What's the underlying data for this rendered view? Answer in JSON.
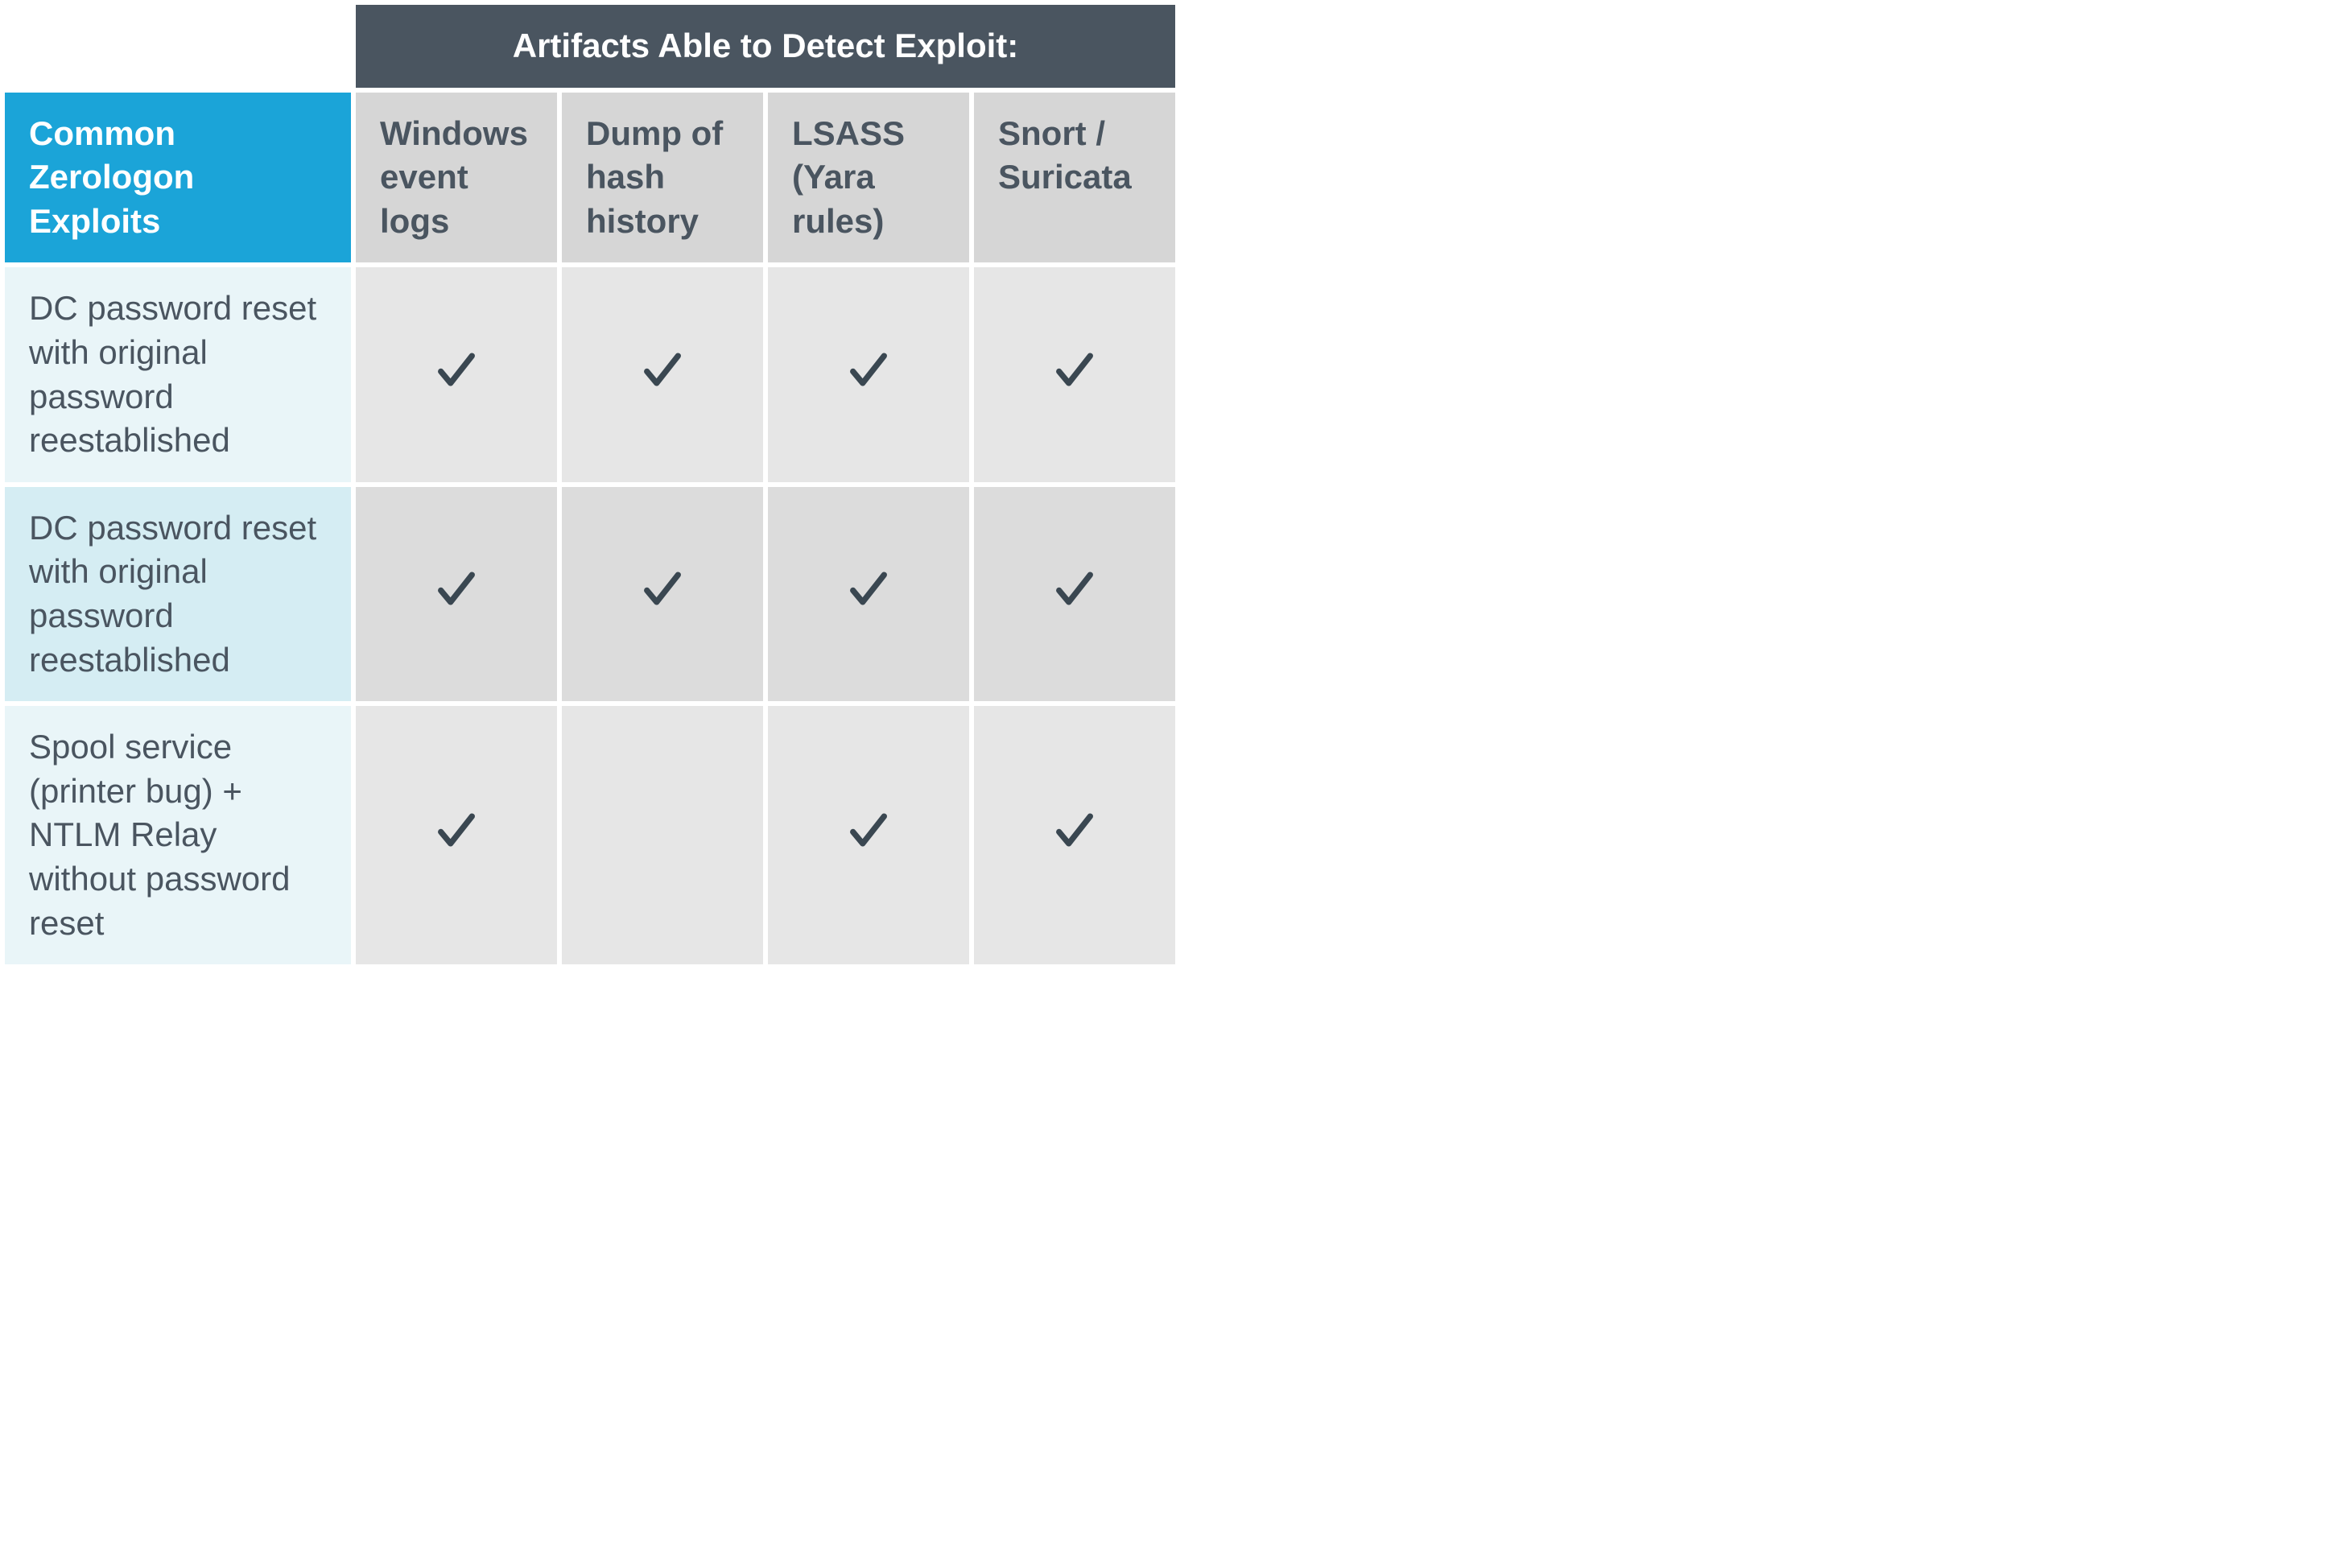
{
  "header": {
    "banner": "Artifacts Able to Detect Exploit:",
    "rowHeader": "Common Zerologon Exploits",
    "columns": [
      "Windows event logs",
      "Dump of hash history",
      "LSASS (Yara rules)",
      "Snort / Suricata"
    ]
  },
  "rows": [
    {
      "label": "DC password reset with original password reestablished",
      "cells": [
        true,
        true,
        true,
        true
      ]
    },
    {
      "label": "DC password reset with original password reestablished",
      "cells": [
        true,
        true,
        true,
        true
      ]
    },
    {
      "label": "Spool service (printer bug) + NTLM Relay without password reset",
      "cells": [
        true,
        false,
        true,
        true
      ]
    }
  ],
  "colors": {
    "bannerBg": "#4a5560",
    "blueHeader": "#1ba4d8",
    "grayHeader": "#d6d6d6",
    "rowA": "#e9f5f8",
    "rowB": "#d5edf3",
    "cellA": "#e6e6e6",
    "cellB": "#dcdcdc",
    "checkColor": "#3a4751"
  },
  "icons": {
    "check": "check-icon"
  },
  "chart_data": {
    "type": "table",
    "title": "Artifacts Able to Detect Exploit:",
    "row_header": "Common Zerologon Exploits",
    "columns": [
      "Windows event logs",
      "Dump of hash history",
      "LSASS (Yara rules)",
      "Snort / Suricata"
    ],
    "rows": [
      {
        "label": "DC password reset with original password reestablished",
        "values": [
          true,
          true,
          true,
          true
        ]
      },
      {
        "label": "DC password reset with original password reestablished",
        "values": [
          true,
          true,
          true,
          true
        ]
      },
      {
        "label": "Spool service (printer bug) + NTLM Relay without password reset",
        "values": [
          true,
          false,
          true,
          true
        ]
      }
    ]
  }
}
